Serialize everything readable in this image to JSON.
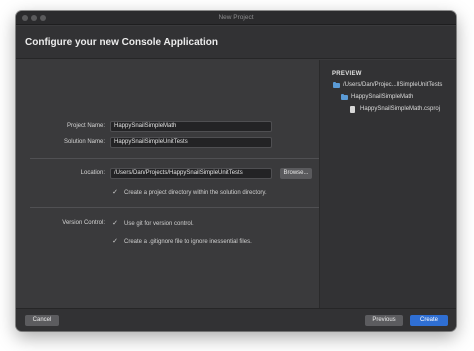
{
  "window": {
    "title": "New Project"
  },
  "header": {
    "title": "Configure your new Console Application"
  },
  "form": {
    "project_name": {
      "label": "Project Name:",
      "value": "HappySnailSimpleMath"
    },
    "solution_name": {
      "label": "Solution Name:",
      "value": "HappySnailSimpleUnitTests"
    },
    "location": {
      "label": "Location:",
      "value": "/Users/Dan/Projects/HappySnailSimpleUnitTests",
      "browse_label": "Browse..."
    },
    "create_directory": {
      "label": "Create a project directory within the solution directory.",
      "checked": true
    },
    "version_control": {
      "label": "Version Control:",
      "use_git": {
        "label": "Use git for version control.",
        "checked": true
      },
      "gitignore": {
        "label": "Create a .gitignore file to ignore inessential files.",
        "checked": true
      }
    }
  },
  "preview": {
    "title": "PREVIEW",
    "items": [
      {
        "label": "/Users/Dan/Projec...llSimpleUnitTests",
        "icon": "folder-icon"
      },
      {
        "label": "HappySnailSimpleMath",
        "icon": "folder-icon"
      },
      {
        "label": "HappySnailSimpleMath.csproj",
        "icon": "file-icon"
      }
    ]
  },
  "footer": {
    "cancel": "Cancel",
    "previous": "Previous",
    "create": "Create"
  },
  "colors": {
    "accent": "#2f6fd4",
    "folder": "#5b9bd6"
  }
}
